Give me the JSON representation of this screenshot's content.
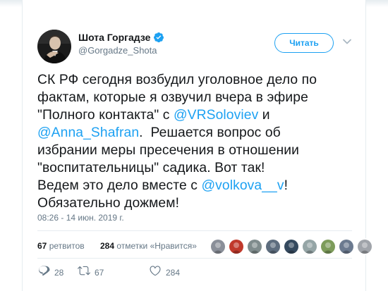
{
  "profile": {
    "display_name": "Шота Горгадзе",
    "handle": "@Gorgadze_Shota",
    "verified": true,
    "avatar": "portrait-avatar"
  },
  "follow_label": "Читать",
  "tweet": {
    "lines": [
      [
        {
          "t": "СК РФ сегодня возбудил уголовное дело по"
        }
      ],
      [
        {
          "t": "фактам, которые я озвучил вчера в эфире"
        }
      ],
      [
        {
          "t": "\"Полного контакта\" с "
        },
        {
          "t": "@VRSoloviev",
          "m": true
        },
        {
          "t": " и"
        }
      ],
      [
        {
          "t": "@Anna_Shafran",
          "m": true
        },
        {
          "t": ".  Решается вопрос об"
        }
      ],
      [
        {
          "t": "избрании меры пресечения в отношении"
        }
      ],
      [
        {
          "t": "\"воспитательницы\" садика. Вот так!"
        }
      ],
      [
        {
          "t": "Ведем это дело вместе с "
        },
        {
          "t": "@volkova__v",
          "m": true
        },
        {
          "t": "!"
        }
      ],
      [
        {
          "t": "Обязательно дожмем!"
        }
      ]
    ]
  },
  "timestamp": "08:26 - 14 июн. 2019 г.",
  "stats": {
    "retweets_count": "67",
    "retweets_label": "ретвитов",
    "likes_count": "284",
    "likes_label": "отметки «Нравится»"
  },
  "liker_avatars": [
    "#8a8f99",
    "#c0392b",
    "#7f8c8d",
    "#5d6d7e",
    "#34495e",
    "#95a5a6",
    "#7d9c5b",
    "#6b7a8f",
    "#a0a4aa"
  ],
  "actions": {
    "reply_count": "28",
    "retweet_count": "67",
    "like_count": "284"
  },
  "colors": {
    "accent": "#1da1f2",
    "text": "#14171a",
    "muted": "#657786",
    "border": "#e6ecf0"
  },
  "icons": {
    "verified": "verified-badge-icon",
    "more": "chevron-down-icon",
    "reply": "reply-icon",
    "retweet": "retweet-icon",
    "like": "heart-icon"
  }
}
